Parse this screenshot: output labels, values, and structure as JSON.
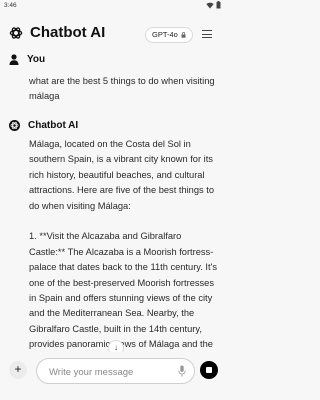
{
  "status_bar": {
    "time": "3:46"
  },
  "header": {
    "title": "Chatbot AI",
    "model": "GPT-4o"
  },
  "user_message": {
    "author": "You",
    "text": "what are the best 5 things to do when visiting málaga"
  },
  "bot_message": {
    "author": "Chatbot AI",
    "text": "Málaga, located on the Costa del Sol in southern Spain, is a vibrant city known for its rich history, beautiful beaches, and cultural attractions. Here are five of the best things to do when visiting Málaga:\n\n1. **Visit the Alcazaba and Gibralfaro Castle:** The Alcazaba is a Moorish fortress-palace that dates back to the 11th century. It's one of the best-preserved Moorish fortresses in Spain and offers stunning views of the city and the Mediterranean Sea. Nearby, the Gibralfaro Castle, built in the 14th century, provides panoramic views of Málaga and the"
  },
  "composer": {
    "placeholder": "Write your message"
  },
  "colors": {
    "background": "#f7f7f8",
    "send_button": "#000000"
  }
}
